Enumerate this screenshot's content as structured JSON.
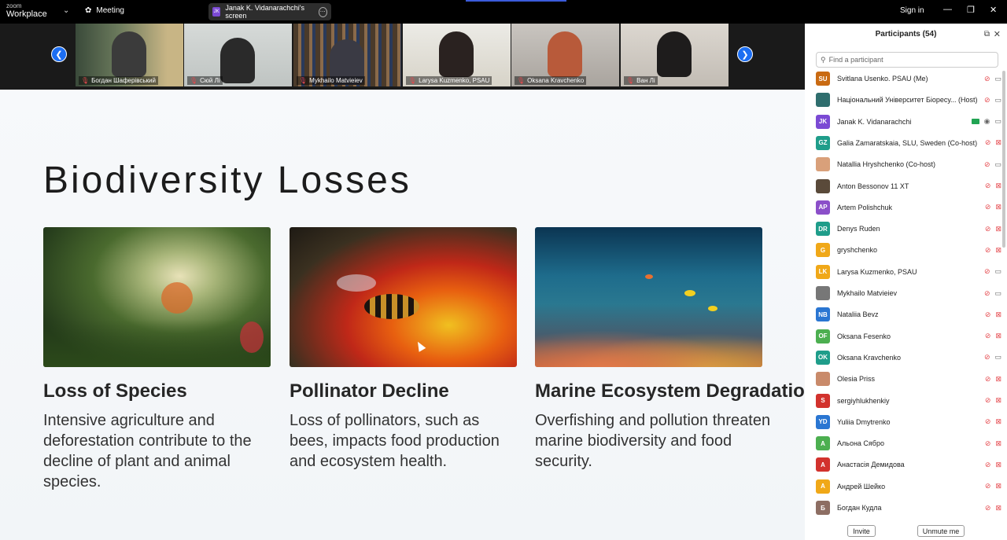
{
  "app": {
    "logo_line1": "zoom",
    "logo_line2": "Workplace",
    "meeting_label": "Meeting",
    "share_label": "Janak K. Vidanarachchi's screen",
    "share_initials": "JK",
    "signin": "Sign in"
  },
  "gallery": {
    "tiles": [
      {
        "name": "Богдан Шаферівський"
      },
      {
        "name": "Сюй Лі"
      },
      {
        "name": "Mykhailo Matvieiev"
      },
      {
        "name": "Larysa Kuzmenko, PSAU"
      },
      {
        "name": "Oksana Kravchenko"
      },
      {
        "name": "Ван Лі"
      }
    ]
  },
  "slide": {
    "title": "Biodiversity Losses",
    "cards": [
      {
        "title": "Loss of Species",
        "desc": "Intensive agriculture and deforestation contribute to the decline of plant and animal species."
      },
      {
        "title": "Pollinator Decline",
        "desc": "Loss of pollinators, such as bees, impacts food production and ecosystem health."
      },
      {
        "title": "Marine Ecosystem Degradation",
        "desc": "Overfishing and pollution threaten marine biodiversity and food security."
      }
    ]
  },
  "panel": {
    "title": "Participants (54)",
    "search_placeholder": "Find a participant",
    "invite": "Invite",
    "unmute": "Unmute me",
    "participants": [
      {
        "initials": "SU",
        "color": "#c96a12",
        "name": "Svitlana Usenko. PSAU (Me)",
        "mic": "muted",
        "video": "on"
      },
      {
        "initials": "",
        "color": "#2f6e6e",
        "name": "Національний Університет Біоресу... (Host)",
        "mic": "muted",
        "video": "on"
      },
      {
        "initials": "JK",
        "color": "#7b4ad4",
        "name": "Janak K. Vidanarachchi",
        "mic": "on",
        "video": "on",
        "sharing": true
      },
      {
        "initials": "GZ",
        "color": "#1f9d8a",
        "name": "Galia Zamaratskaia, SLU, Sweden (Co-host)",
        "mic": "muted",
        "video": "off"
      },
      {
        "initials": "",
        "color": "#d9a07a",
        "name": "Natallia Hryshchenko (Co-host)",
        "mic": "muted",
        "video": "on"
      },
      {
        "initials": "",
        "color": "#5a4a3a",
        "name": "Anton Bessonov 11 XT",
        "mic": "muted",
        "video": "off"
      },
      {
        "initials": "AP",
        "color": "#8b4fc9",
        "name": "Artem Polishchuk",
        "mic": "muted",
        "video": "off"
      },
      {
        "initials": "DR",
        "color": "#1f9d8a",
        "name": "Denys Ruden",
        "mic": "muted",
        "video": "off"
      },
      {
        "initials": "G",
        "color": "#f0a818",
        "name": "gryshchenko",
        "mic": "muted",
        "video": "off"
      },
      {
        "initials": "LK",
        "color": "#f0a818",
        "name": "Larysa Kuzmenko, PSAU",
        "mic": "muted",
        "video": "on"
      },
      {
        "initials": "",
        "color": "#777777",
        "name": "Mykhailo Matvieiev",
        "mic": "muted",
        "video": "on"
      },
      {
        "initials": "NB",
        "color": "#2a76d2",
        "name": "Nataliia Bevz",
        "mic": "muted",
        "video": "off"
      },
      {
        "initials": "OF",
        "color": "#4caf50",
        "name": "Oksana Fesenko",
        "mic": "muted",
        "video": "off"
      },
      {
        "initials": "OK",
        "color": "#1f9d8a",
        "name": "Oksana Kravchenko",
        "mic": "muted",
        "video": "on"
      },
      {
        "initials": "",
        "color": "#c98a6a",
        "name": "Olesia Priss",
        "mic": "muted",
        "video": "off"
      },
      {
        "initials": "S",
        "color": "#d2322d",
        "name": "sergiyhlukhenkiy",
        "mic": "muted",
        "video": "off"
      },
      {
        "initials": "YD",
        "color": "#2a76d2",
        "name": "Yuliia Dmytrenko",
        "mic": "muted",
        "video": "off"
      },
      {
        "initials": "А",
        "color": "#4caf50",
        "name": "Альона Сябро",
        "mic": "muted",
        "video": "off"
      },
      {
        "initials": "А",
        "color": "#d2322d",
        "name": "Анастасія Демидова",
        "mic": "muted",
        "video": "off"
      },
      {
        "initials": "А",
        "color": "#f0a818",
        "name": "Андрей Шейко",
        "mic": "muted",
        "video": "off"
      },
      {
        "initials": "Б",
        "color": "#8d6e63",
        "name": "Богдан Кудла",
        "mic": "muted",
        "video": "off"
      }
    ]
  }
}
